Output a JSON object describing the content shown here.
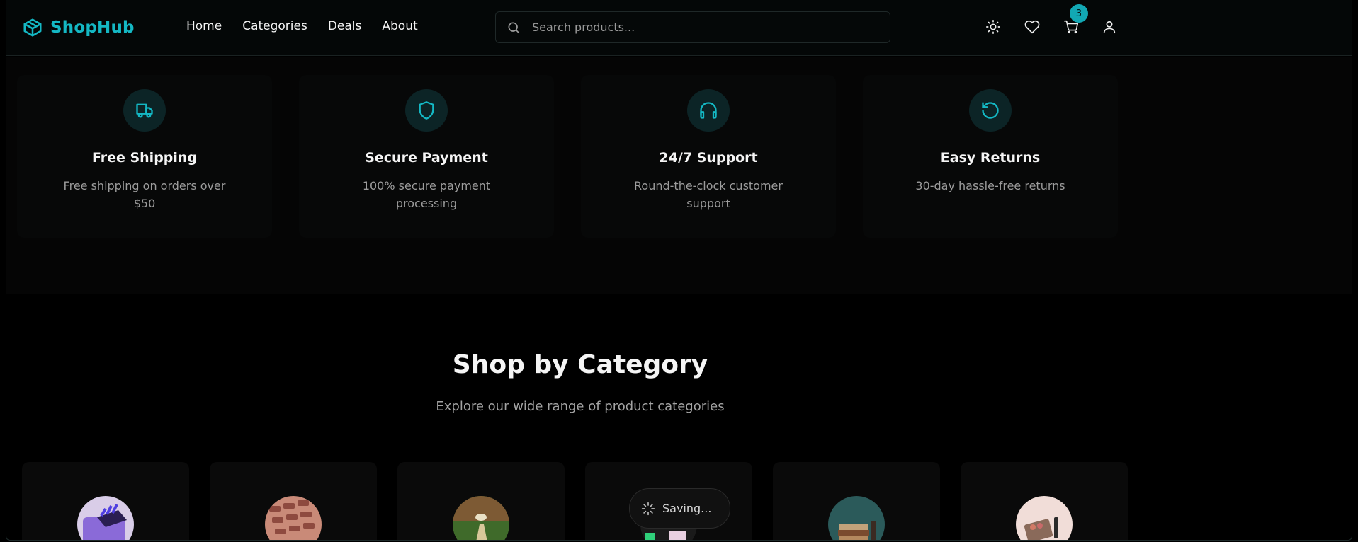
{
  "header": {
    "brand": "ShopHub",
    "nav": [
      "Home",
      "Categories",
      "Deals",
      "About"
    ],
    "search_placeholder": "Search products...",
    "cart_count": "3",
    "icons": [
      "sun-icon",
      "heart-icon",
      "cart-icon",
      "user-icon"
    ]
  },
  "features": [
    {
      "icon": "truck-icon",
      "title": "Free Shipping",
      "desc": "Free shipping on orders over $50"
    },
    {
      "icon": "shield-icon",
      "title": "Secure Payment",
      "desc": "100% secure payment processing"
    },
    {
      "icon": "headphones-icon",
      "title": "24/7 Support",
      "desc": "Round-the-clock customer support"
    },
    {
      "icon": "rotate-ccw-icon",
      "title": "Easy Returns",
      "desc": "30-day hassle-free returns"
    }
  ],
  "categories": {
    "title": "Shop by Category",
    "subtitle": "Explore our wide range of product categories"
  },
  "toast": {
    "label": "Saving..."
  },
  "colors": {
    "accent": "#14b8c4",
    "background": "#000000"
  }
}
